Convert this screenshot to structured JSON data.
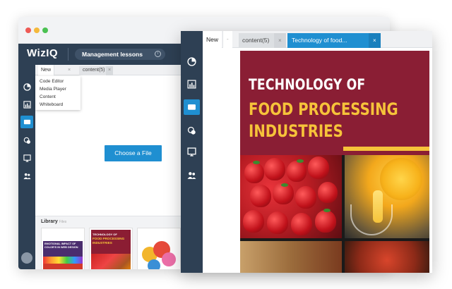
{
  "app": {
    "logo": "WizIQ",
    "lesson_title": "Management lessons",
    "info_glyph": "i"
  },
  "back": {
    "tabs": {
      "new": "New",
      "new_close": "×",
      "content": "content(5)",
      "content_close": "×"
    },
    "dropdown": [
      "Code Editor",
      "Media Player",
      "Content",
      "Whiteboard"
    ],
    "choose_button": "Choose a File",
    "library": {
      "title": "Library",
      "subtitle": "Files",
      "thumbs": [
        {
          "title": "EMOTIONAL IMPACT OF COLOR'S IN WEB DESIGN"
        },
        {
          "title": "TECHNOLOGY OF",
          "sub": "FOOD PROCESSING INDUSTRIES"
        },
        {
          "title": ""
        }
      ]
    }
  },
  "front": {
    "tabs": {
      "new": "New",
      "new_close": "-",
      "content": "content(5)",
      "content_close": "×",
      "active": "Technology of food...",
      "active_close": "×"
    },
    "document": {
      "title": "TECHNOLOGY OF",
      "subtitle_line1": "FOOD PROCESSING",
      "subtitle_line2": "INDUSTRIES"
    }
  },
  "colors": {
    "sidebar": "#2e4054",
    "accent": "#1f8fd1",
    "cover": "#8a1e34",
    "cover_title": "#ffffff",
    "cover_sub": "#f6c33a"
  },
  "icons": {
    "sidebar": [
      "pie-chart-icon",
      "bar-chart-icon",
      "screen-icon",
      "chat-icon",
      "presentation-icon",
      "users-icon"
    ]
  }
}
